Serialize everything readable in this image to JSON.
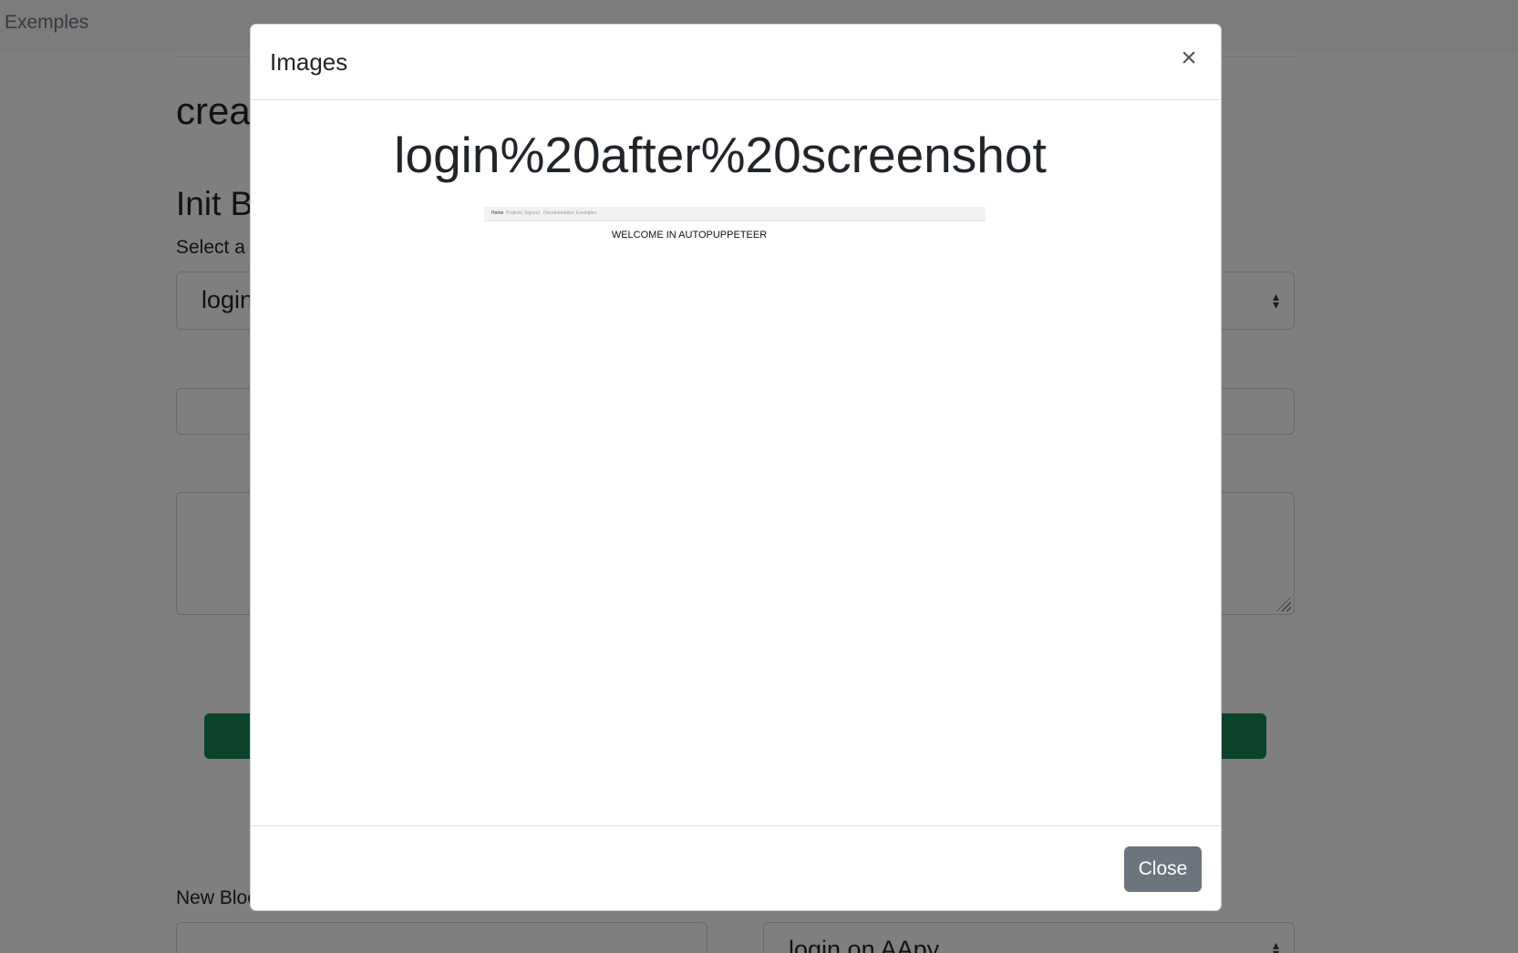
{
  "background": {
    "nav": {
      "item_examples": "Exemples"
    },
    "page_title": "create",
    "section_title": "Init Block",
    "select_label": "Select a block",
    "select_value": "login",
    "new_block_label": "New Block",
    "new_block_select_value": "login on AApy"
  },
  "modal": {
    "title": "Images",
    "close_symbol": "×",
    "image_title": "login%20after%20screenshot",
    "screenshot": {
      "nav_items": [
        "Home",
        "Projects",
        "Signout",
        "Documentation",
        "Exemples"
      ],
      "heading": "WELCOME IN AUTOPUPPETEER"
    },
    "close_button": "Close"
  },
  "colors": {
    "success": "#198754",
    "secondary": "#6c757d",
    "backdrop": "rgba(0,0,0,0.5)"
  }
}
